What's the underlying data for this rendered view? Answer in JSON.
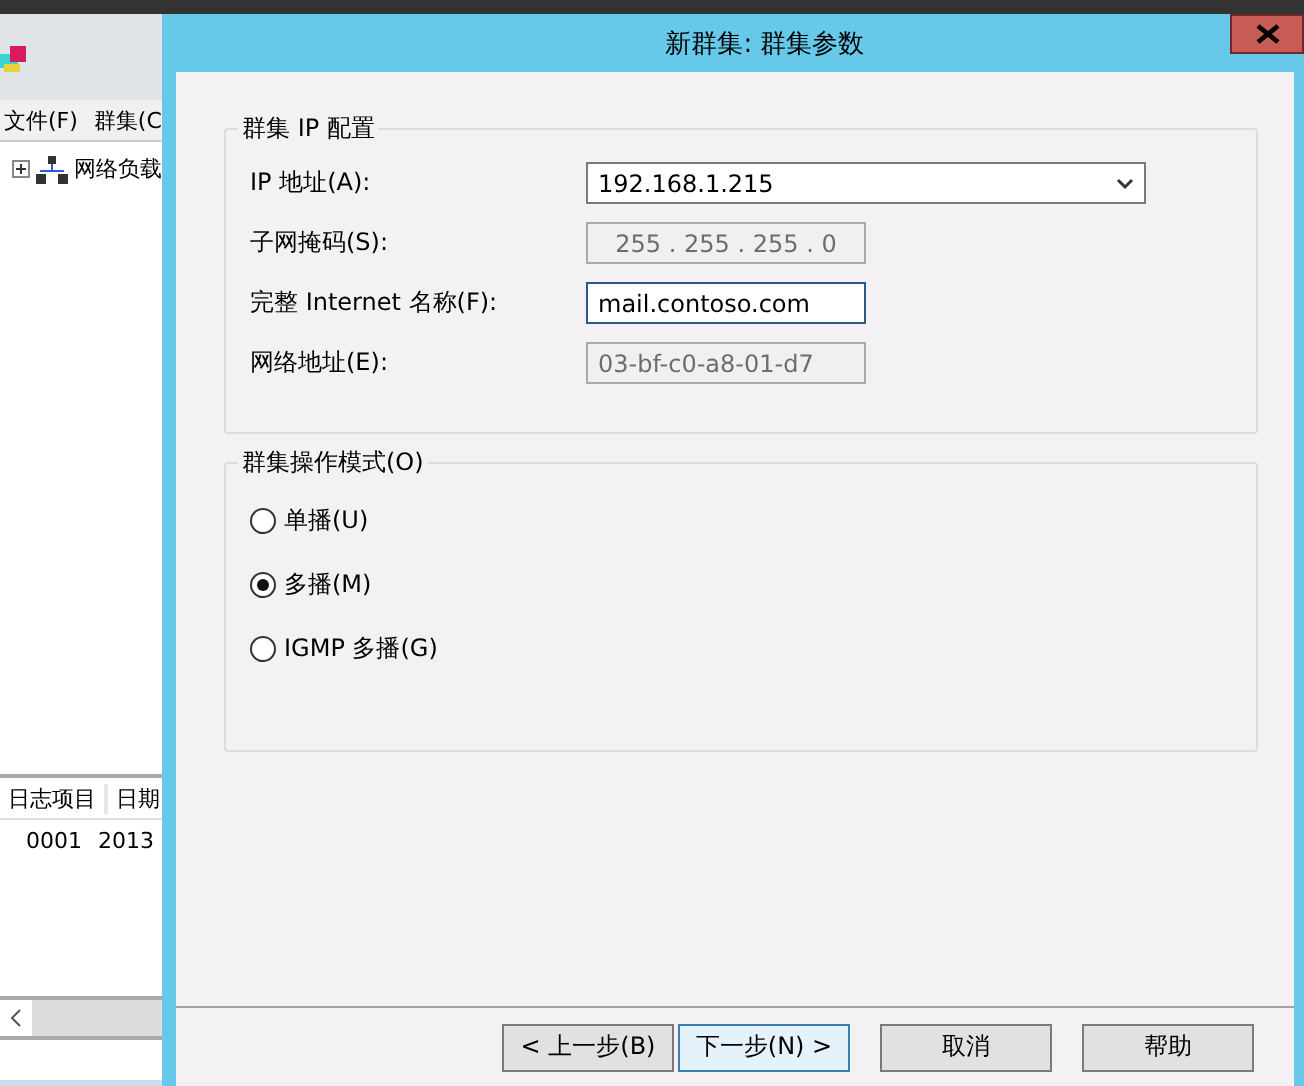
{
  "background_app": {
    "menu": [
      "文件(F)",
      "群集(C"
    ],
    "tree": [
      {
        "label": "网络负载",
        "expanded": false
      }
    ],
    "log": {
      "columns": [
        "日志项目",
        "日期"
      ],
      "rows": [
        [
          "0001",
          "2013"
        ]
      ]
    }
  },
  "dialog": {
    "title": "新群集: 群集参数",
    "ip_group": {
      "title": "群集 IP 配置",
      "fields": [
        {
          "kind": "combo",
          "label": "IP 地址(A):",
          "value": "192.168.1.215",
          "disabled": false
        },
        {
          "kind": "ip",
          "label": "子网掩码(S):",
          "value": "255 . 255 . 255 .  0",
          "disabled": true
        },
        {
          "kind": "text",
          "label": "完整 Internet 名称(F):",
          "value": "mail.contoso.com",
          "disabled": false,
          "focused": true
        },
        {
          "kind": "text",
          "label": "网络地址(E):",
          "value": "03-bf-c0-a8-01-d7",
          "disabled": true,
          "focused": false
        }
      ]
    },
    "mode_group": {
      "title": "群集操作模式(O)",
      "options": [
        {
          "label": "单播(U)",
          "selected": false
        },
        {
          "label": "多播(M)",
          "selected": true
        },
        {
          "label": "IGMP 多播(G)",
          "selected": false
        }
      ]
    },
    "buttons": [
      {
        "label": "< 上一步(B)",
        "default": false
      },
      {
        "label": "下一步(N) >",
        "default": true
      },
      {
        "label": "取消",
        "default": false
      },
      {
        "label": "帮助",
        "default": false
      }
    ]
  }
}
